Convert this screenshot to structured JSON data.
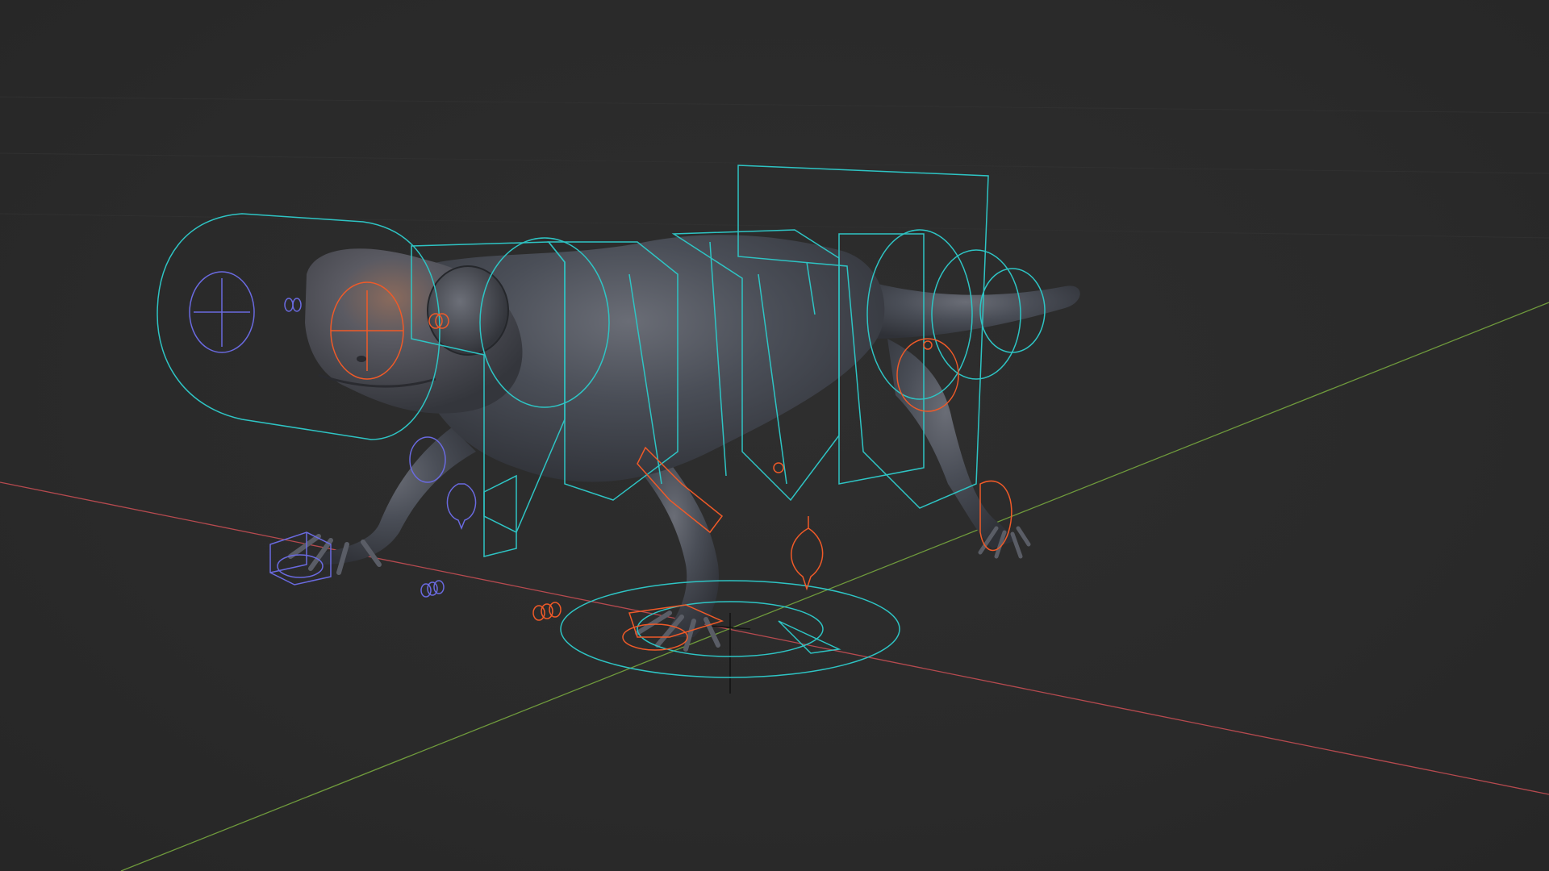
{
  "viewport": {
    "mode": "3d-viewport",
    "background_color": "#2b2b2b",
    "grid_line_color": "#303030"
  },
  "axes": {
    "x_axis_color": "#b64a4f",
    "y_axis_color": "#6f9a3c"
  },
  "model": {
    "subject": "salamander",
    "mesh_color": "#4a4e57",
    "highlight_color": "#c07a52"
  },
  "rig": {
    "fk_control_color": "#2ec4c4",
    "ik_control_color": "#f05a28",
    "root_control_color": "#6a6ae0"
  },
  "icons": {
    "origin": "origin-cross-icon",
    "head_target": "crosshair-circle-icon"
  }
}
